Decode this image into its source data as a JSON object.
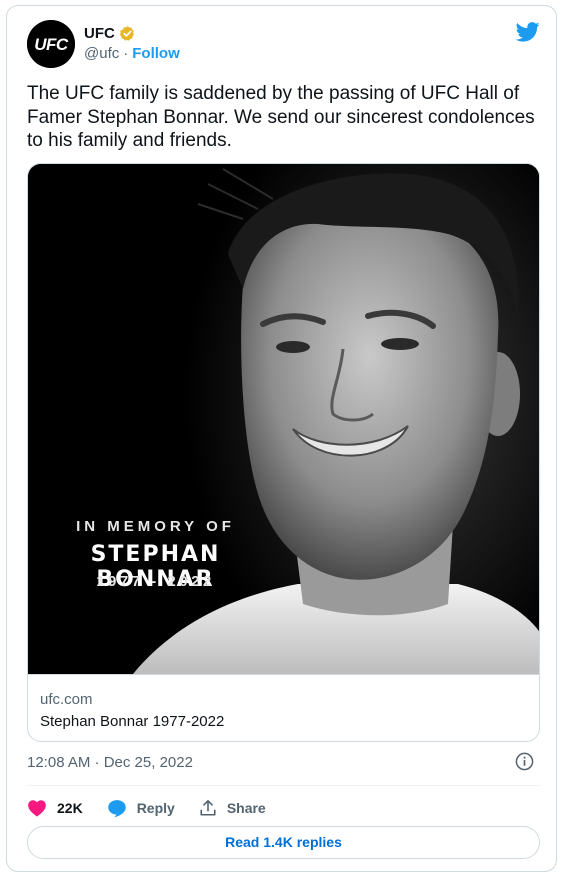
{
  "account": {
    "name": "UFC",
    "handle": "@ufc",
    "separator": "·",
    "follow_label": "Follow",
    "logo_text": "UFC",
    "verified_color": "#e8b62c"
  },
  "tweet": {
    "text": "The UFC family is saddened by the passing of UFC Hall of Famer Stephan Bonnar. We send our sincerest condolences to his family and friends.",
    "timestamp": "12:08 AM · Dec 25, 2022"
  },
  "media": {
    "memory_line": "IN MEMORY OF",
    "memory_name": "STEPHAN BONNAR",
    "memory_years": "1977 - 2022",
    "link_domain": "ufc.com",
    "link_title": "Stephan Bonnar 1977-2022"
  },
  "actions": {
    "likes_count": "22K",
    "reply_label": "Reply",
    "share_label": "Share",
    "like_color": "#f91880",
    "reply_color": "#1d9bf0"
  },
  "footer": {
    "read_replies_label": "Read 1.4K replies"
  },
  "icons": [
    "twitter-bird-icon",
    "verified-badge-icon",
    "info-icon",
    "heart-icon",
    "reply-bubble-icon",
    "share-icon"
  ]
}
